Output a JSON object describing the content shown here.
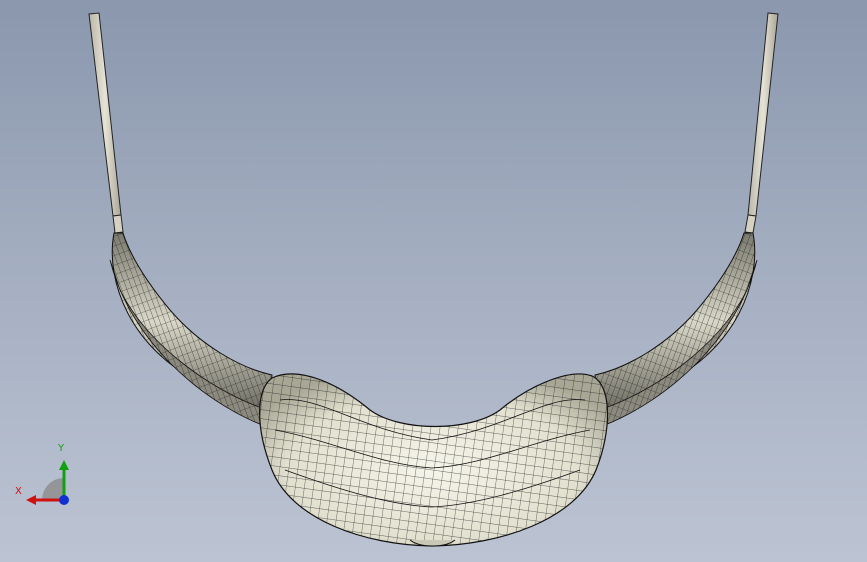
{
  "viewport": {
    "background_top": "#8a97ad",
    "background_bottom": "#bcc4d3"
  },
  "model": {
    "description_icon": "cad-mesh-model-icon",
    "surface_color": "#ecebdc",
    "mesh_line_color": "#1a1a1a",
    "rod_color": "#d8d5c8"
  },
  "triad": {
    "x_label": "X",
    "y_label": "Y",
    "x_color": "#d11010",
    "y_color": "#11a011",
    "z_color": "#1030d0"
  }
}
